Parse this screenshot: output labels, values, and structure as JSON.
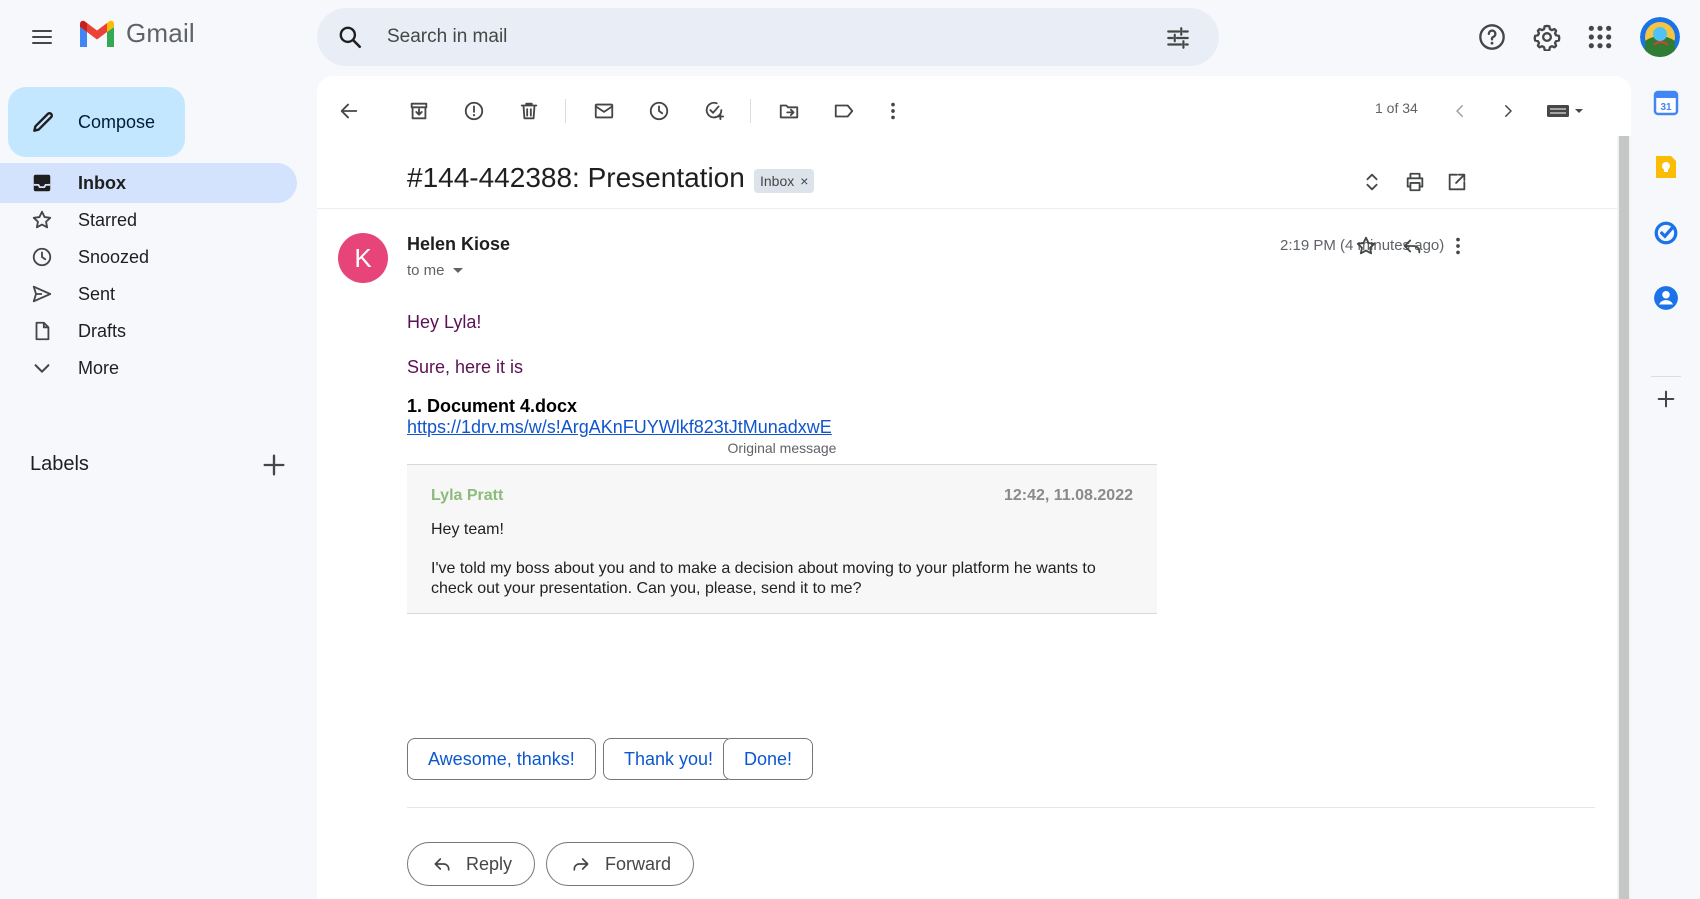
{
  "app": {
    "name": "Gmail"
  },
  "search": {
    "placeholder": "Search in mail"
  },
  "sidebar": {
    "compose_label": "Compose",
    "items": [
      {
        "label": "Inbox"
      },
      {
        "label": "Starred"
      },
      {
        "label": "Snoozed"
      },
      {
        "label": "Sent"
      },
      {
        "label": "Drafts"
      },
      {
        "label": "More"
      }
    ],
    "labels_heading": "Labels"
  },
  "toolbar": {
    "pager": "1 of 34"
  },
  "email": {
    "subject": "#144-442388: Presentation",
    "label_chip": "Inbox",
    "label_chip_close": "×",
    "sender_initial": "K",
    "sender_name": "Helen Kiose",
    "recipient": "to me",
    "time": "2:19 PM (4 minutes ago)",
    "greeting": "Hey Lyla!",
    "line1": "Sure, here it is",
    "doc_title": "1. Document 4.docx",
    "doc_link": "https://1drv.ms/w/s!ArgAKnFUYWlkf823tJtMunadxwE",
    "original_label": "Original message",
    "original": {
      "from": "Lyla Pratt",
      "date": "12:42, 11.08.2022",
      "greeting": "Hey team!",
      "text": "I've told my boss about you and to make a decision about moving to your platform he wants to check out your presentation. Can you, please, send it to me?"
    }
  },
  "smart_replies": [
    "Awesome, thanks!",
    "Thank you!",
    "Done!"
  ],
  "actions": {
    "reply": "Reply",
    "forward": "Forward"
  },
  "side_panel": {
    "calendar_day": "31"
  },
  "colors": {
    "accent": "#0b57d0",
    "compose_bg": "#c2e7ff",
    "active_nav": "#d3e3fd",
    "sender_avatar": "#e7457a",
    "body_text": "#5c1154",
    "link": "#1155cc"
  }
}
